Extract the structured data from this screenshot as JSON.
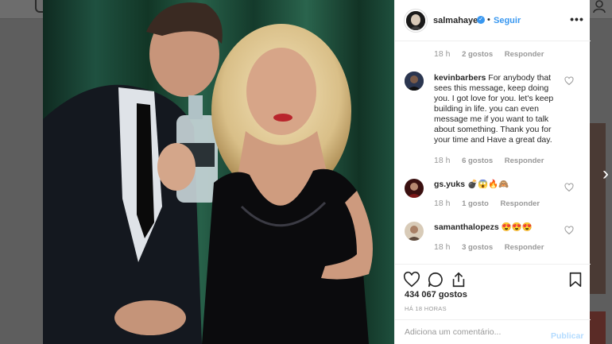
{
  "post": {
    "username": "salmahayek",
    "follow_label": "Seguir",
    "more_label": "•••",
    "likes": "434 067 gostos",
    "posted_ago": "HÁ 18 HORAS"
  },
  "first_meta": {
    "time": "18 h",
    "likes": "2 gostos",
    "reply": "Responder"
  },
  "comments": [
    {
      "username": "kevinbarbers",
      "text": "For anybody that sees this message, keep doing you. I got love for you. let's keep building in life. you can even message me if you want to talk about something. Thank you for your time and Have a great day.",
      "time": "18 h",
      "likes": "6 gostos",
      "reply": "Responder"
    },
    {
      "username": "gs.yuks",
      "text": "💣😱🔥🙈",
      "time": "18 h",
      "likes": "1 gosto",
      "reply": "Responder"
    },
    {
      "username": "samanthalopezs",
      "text": "😍😍😍",
      "time": "18 h",
      "likes": "3 gostos",
      "reply": "Responder"
    }
  ],
  "comment_box": {
    "placeholder": "Adiciona um comentário...",
    "publish_label": "Publicar"
  },
  "colors": {
    "accent": "#3897f0",
    "publish_disabled": "#b3dbff",
    "meta": "#999999"
  },
  "icons": [
    "heart-icon",
    "comment-icon",
    "share-icon",
    "bookmark-icon",
    "more-options-icon",
    "verified-badge-icon",
    "next-arrow-icon"
  ]
}
